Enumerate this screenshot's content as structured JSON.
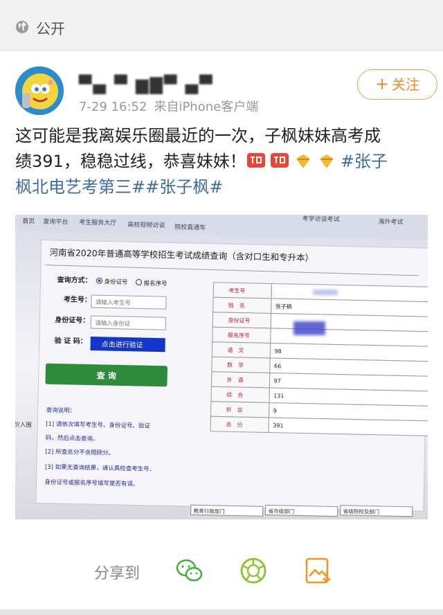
{
  "header": {
    "visibility_label": "公开",
    "visibility_icon": "globe-icon"
  },
  "post": {
    "username": "▀▄ ▀ ▆▇▀ ▄▀",
    "time": "7-29 16:52",
    "source": "来自iPhone客户端",
    "follow_label": "关注",
    "text_line1": "这可能是我离娱乐圈最近的一次，子枫妹妹高考成",
    "text_line2": "绩391，稳稳过线，恭喜妹妹！",
    "hashtag_part1": "#张子",
    "hashtag_part2": "枫北电艺考第三#",
    "hashtag2": "#张子枫#"
  },
  "photo": {
    "nav": [
      "首页",
      "查询平台",
      "考生服务大厅",
      "高校视频访谈",
      "院校直通车",
      "考学访谈考试",
      "海外考试"
    ],
    "page_title": "河南省2020年普通高等学校招生考试成绩查询（含对口生和专升本）",
    "query_mode_label": "查询方式：",
    "opt_id": "身份证号",
    "opt_reg": "报名序号",
    "exam_no_label": "考生号：",
    "exam_no_placeholder": "请输入考生号",
    "id_label": "身份证号：",
    "id_placeholder": "请输入身份证",
    "verify_label": "验 证 码：",
    "verify_button": "点击进行验证",
    "query_button": "查 询",
    "instructions": [
      "查询说明：",
      "[1] 请依次填写考生号、身份证号、验证",
      "码，然后点击查询。",
      "[2] 所查总分不含照顾分。",
      "[3] 如果无查询结果，请认真检查考生号、",
      "身份证号或报名序号填写是否有误。"
    ],
    "side_text": "价入围",
    "results": [
      {
        "label": "考生号",
        "value": ""
      },
      {
        "label": "姓　名",
        "value": "张子枫"
      },
      {
        "label": "身份证号",
        "value": ""
      },
      {
        "label": "报名序号",
        "value": ""
      },
      {
        "label": "语　文",
        "value": "98"
      },
      {
        "label": "数　学",
        "value": "66"
      },
      {
        "label": "外　语",
        "value": "97"
      },
      {
        "label": "综　合",
        "value": "131"
      },
      {
        "label": "折　合",
        "value": "9"
      },
      {
        "label": "总　分",
        "value": "391"
      }
    ],
    "footer_selects": [
      "教育行政部门",
      "省市级部门",
      "省级院校及部门"
    ]
  },
  "share": {
    "label": "分享到"
  },
  "colors": {
    "accent": "#f08a24",
    "link": "#3b6ea5",
    "verify_blue": "#1436c8",
    "query_green": "#2e8b3c",
    "result_label": "#c02020"
  }
}
